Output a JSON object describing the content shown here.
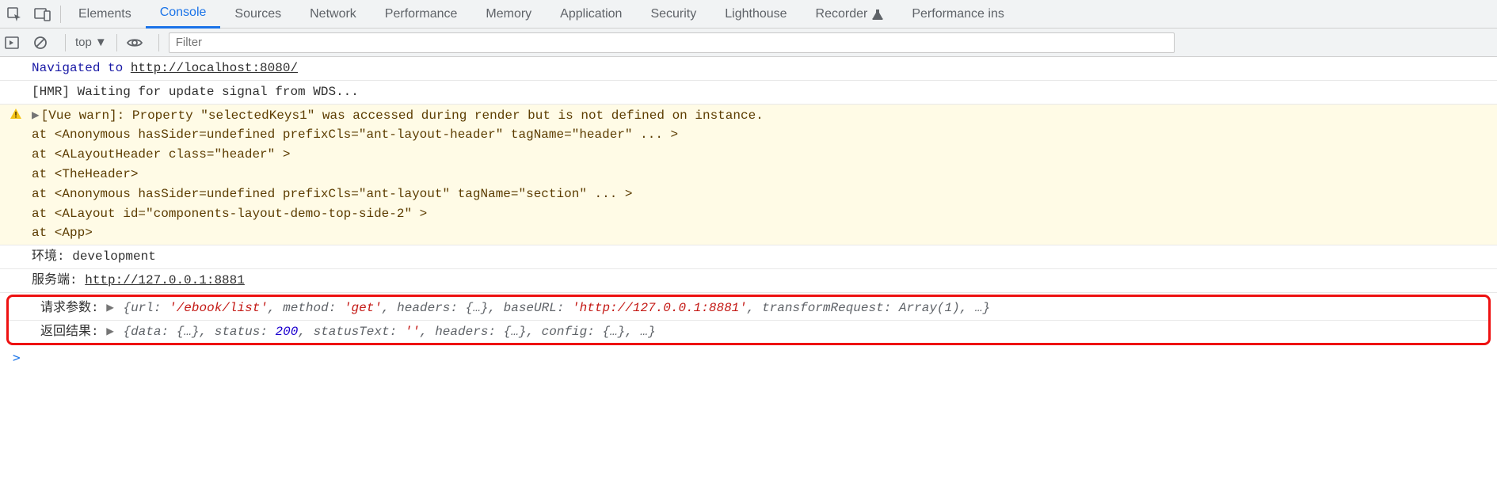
{
  "tabs": {
    "elements": "Elements",
    "console": "Console",
    "sources": "Sources",
    "network": "Network",
    "performance": "Performance",
    "memory": "Memory",
    "application": "Application",
    "security": "Security",
    "lighthouse": "Lighthouse",
    "recorder": "Recorder",
    "perf_ins": "Performance ins"
  },
  "toolbar": {
    "context": "top",
    "filter_placeholder": "Filter"
  },
  "log": {
    "nav_prefix": "Navigated to ",
    "nav_url": "http://localhost:8080/",
    "hmr": "[HMR] Waiting for update signal from WDS...",
    "warn_l1": "[Vue warn]: Property \"selectedKeys1\" was accessed during render but is not defined on instance. ",
    "warn_l2": "  at <Anonymous hasSider=undefined prefixCls=\"ant-layout-header\" tagName=\"header\"  ... > ",
    "warn_l3": "  at <ALayoutHeader class=\"header\" > ",
    "warn_l4": "  at <TheHeader> ",
    "warn_l5": "  at <Anonymous hasSider=undefined prefixCls=\"ant-layout\" tagName=\"section\"  ... > ",
    "warn_l6": "  at <ALayout id=\"components-layout-demo-top-side-2\" > ",
    "warn_l7": "  at <App>",
    "env_label": "环境: ",
    "env_value": " development",
    "srv_label": "服务端: ",
    "srv_url": "http://127.0.0.1:8881",
    "req_label": "请求参数: ",
    "req_brace_open": "{",
    "req_k_url": "url:",
    "req_v_url": "'/ebook/list'",
    "req_k_method": ", method:",
    "req_v_method": "'get'",
    "req_k_headers": ", headers:",
    "req_v_headers": "{…}",
    "req_k_base": ", baseURL:",
    "req_v_base": "'http://127.0.0.1:8881'",
    "req_k_tr": ", transformRequest:",
    "req_v_tr": "Array(1)",
    "req_rest": ", …}",
    "res_label": "返回结果: ",
    "res_brace_open": "{",
    "res_k_data": "data:",
    "res_v_data": "{…}",
    "res_k_status": ", status:",
    "res_v_status": "200",
    "res_k_st": ", statusText:",
    "res_v_st": "''",
    "res_k_hdr": ", headers:",
    "res_v_hdr": "{…}",
    "res_k_cfg": ", config:",
    "res_v_cfg": "{…}",
    "res_rest": ", …}"
  },
  "prompt": ">"
}
